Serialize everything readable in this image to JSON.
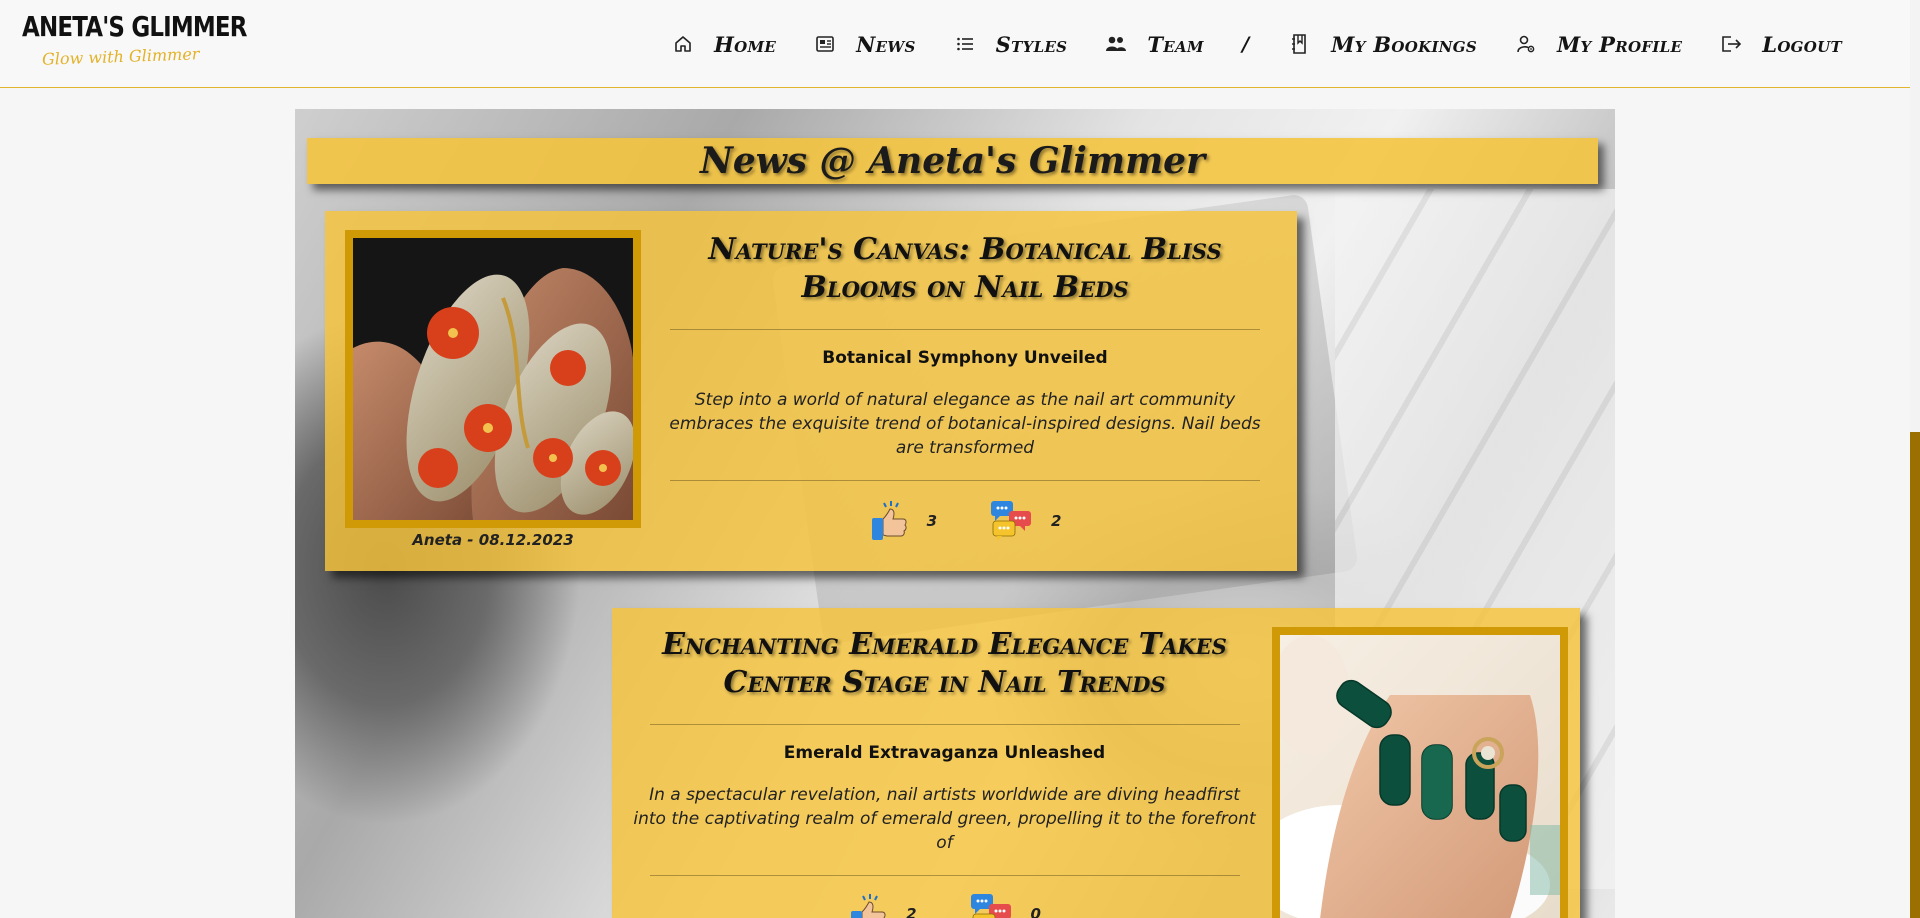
{
  "brand": {
    "name": "ANETA'S GLIMMER",
    "tagline": "Glow with Glimmer"
  },
  "nav": {
    "items": [
      {
        "label": "Home",
        "icon": "home-icon"
      },
      {
        "label": "News",
        "icon": "newspaper-icon"
      },
      {
        "label": "Styles",
        "icon": "list-icon"
      },
      {
        "label": "Team",
        "icon": "team-icon"
      }
    ],
    "separator": "/",
    "user_items": [
      {
        "label": "My Bookings",
        "icon": "bookings-icon"
      },
      {
        "label": "My Profile",
        "icon": "profile-icon"
      },
      {
        "label": "Logout",
        "icon": "logout-icon"
      }
    ]
  },
  "page": {
    "title": "News @ Aneta's Glimmer"
  },
  "articles": [
    {
      "title": "Nature's Canvas: Botanical Bliss Blooms on Nail Beds",
      "subtitle": "Botanical Symphony Unveiled",
      "excerpt": "Step into a world of natural elegance as the nail art community embraces the exquisite trend of botanical-inspired designs. Nail beds are transformed",
      "author_date": "Aneta - 08.12.2023",
      "likes": "3",
      "comments": "2"
    },
    {
      "title": "Enchanting Emerald Elegance Takes Center Stage in Nail Trends",
      "subtitle": "Emerald Extravaganza Unleashed",
      "excerpt": "In a spectacular revelation, nail artists worldwide are diving headfirst into the captivating realm of emerald green, propelling it to the forefront of",
      "likes": "2",
      "comments": "0"
    }
  ],
  "colors": {
    "accent": "#f5c43c",
    "frame": "#cf9a05",
    "text": "#141414"
  }
}
